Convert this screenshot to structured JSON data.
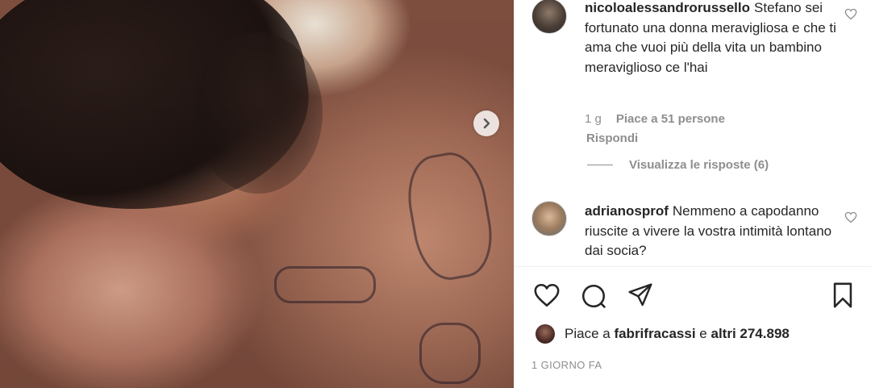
{
  "comments": [
    {
      "username": "nicoloalessandrorussello",
      "text": "Stefano sei fortunato una donna meravigliosa e che ti ama che vuoi più della vita un bambino meraviglioso ce l'hai",
      "time": "1 g",
      "likes": "Piace a 51 persone",
      "reply_label": "Rispondi",
      "view_replies": "Visualizza le risposte (6)"
    },
    {
      "username": "adrianosprof",
      "text": "Nemmeno a capodanno riuscite a vivere la vostra intimità lontano dai socia?"
    }
  ],
  "likes": {
    "prefix": "Piace a",
    "user": "fabrifracassi",
    "conjunction": "e",
    "others": "altri 274.898"
  },
  "post_date": "1 GIORNO FA",
  "icons": {
    "next": "chevron-right-icon",
    "like": "heart-icon",
    "comment": "comment-icon",
    "share": "paper-plane-icon",
    "save": "bookmark-icon"
  }
}
